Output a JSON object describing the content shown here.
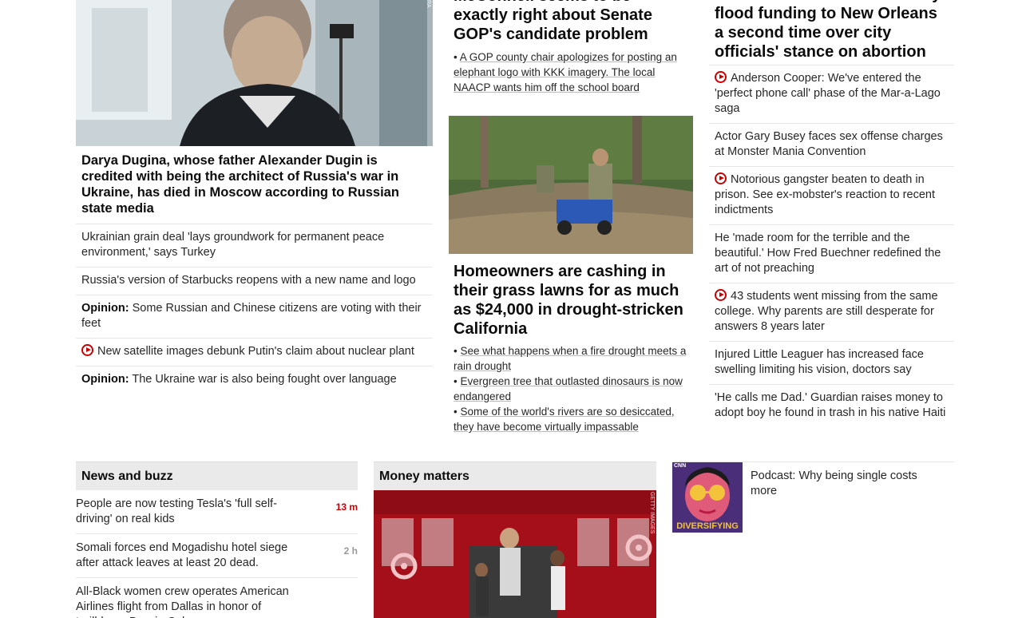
{
  "col1": {
    "hero_headline": "Darya Dugina, whose father Alexander Dugin is credited with being the architect of Russia's war in Ukraine, has died in Moscow according to Russian state media",
    "items": [
      {
        "prefix": "",
        "text": "Ukrainian grain deal 'lays groundwork for permanent peace environment,' says Turkey",
        "video": false
      },
      {
        "prefix": "",
        "text": "Russia's version of Starbucks reopens with a new name and logo",
        "video": false
      },
      {
        "prefix": "Opinion:",
        "text": " Some Russian and Chinese citizens are voting with their feet",
        "video": false
      },
      {
        "prefix": "",
        "text": "New satellite images debunk Putin's claim about nuclear plant",
        "video": true
      },
      {
        "prefix": "Opinion:",
        "text": " The Ukraine war is also being fought over language",
        "video": false
      }
    ]
  },
  "col2": {
    "top_headline": "McConnell seems to be exactly right about Senate GOP's candidate problem",
    "top_sub": "A GOP county chair apologizes for posting an elephant logo with KKK imagery. The local NAACP wants him off the school board",
    "headline": "Homeowners are cashing in their grass lawns for as much as $24,000 in drought-stricken California",
    "subs": [
      "See what happens when a fire drought meets a rain drought",
      "Evergreen tree that outlasted dinosaurs is now endangered",
      "Some of the world's rivers are so desiccated, they have become virtually impassable"
    ]
  },
  "col3": {
    "top_headline": "Louisiana state officials delay flood funding to New Orleans a second time over city officials' stance on abortion",
    "items": [
      {
        "text": "Anderson Cooper: We've entered the 'perfect phone call' phase of the Mar-a-Lago saga",
        "video": true
      },
      {
        "text": "Actor Gary Busey faces sex offense charges at Monster Mania Convention",
        "video": false
      },
      {
        "text": "Notorious gangster beaten to death in prison. See ex-mobster's reaction to recent indictments",
        "video": true
      },
      {
        "text": "He 'made room for the terrible and the beautiful.' How Fred Buechner redefined the art of not preaching",
        "video": false
      },
      {
        "text": "43 students went missing from the same college. Why parents are still desperate for answers 8 years later",
        "video": true
      },
      {
        "text": "Injured Little Leaguer has increased face swelling limiting his vision, doctors say",
        "video": false
      },
      {
        "text": "'He calls me Dad.' Guardian raises money to adopt boy he found in trash in his native Haiti",
        "video": false
      }
    ]
  },
  "news_buzz": {
    "title": "News and buzz",
    "items": [
      {
        "text": "People are now testing Tesla's 'full self-driving' on real kids",
        "time": "13 m",
        "recent": true
      },
      {
        "text": "Somali forces end Mogadishu hotel siege after attack leaves at least 20 dead.",
        "time": "2 h",
        "recent": false
      },
      {
        "text": "All-Black women crew operates American Airlines flight from Dallas in honor of trailblazer Bessie Coleman",
        "time": "",
        "recent": false
      }
    ]
  },
  "money": {
    "title": "Money matters",
    "podcast_text": "Podcast: Why being single costs more",
    "podcast_logo_text": "DIVERSIFYING",
    "podcast_brand": "CNN"
  },
  "colors": {
    "accent": "#cc0000",
    "section_bg": "#eaeaea",
    "divider": "#e6e6e6"
  }
}
